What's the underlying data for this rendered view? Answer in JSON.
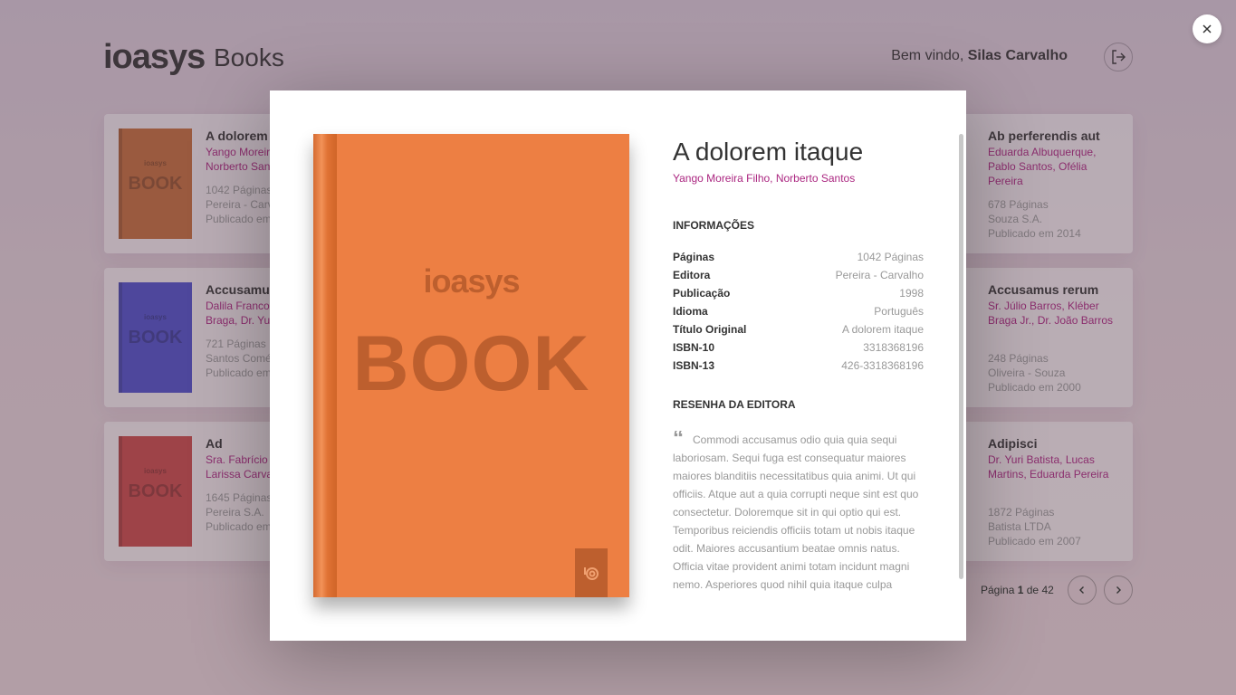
{
  "header": {
    "logo": "ioasys",
    "app_name": "Books",
    "welcome_prefix": "Bem vindo,",
    "user_name": "Silas Carvalho"
  },
  "cards_left": [
    {
      "title": "A dolorem i",
      "authors": [
        "Yango Moreir",
        "Norberto San"
      ],
      "pages": "1042 Páginas",
      "publisher": "Pereira - Carv",
      "published": "Publicado em",
      "color": "#c26a3a"
    },
    {
      "title": "Accusamus",
      "authors": [
        "Dalila Franco",
        "Braga, Dr. Yur"
      ],
      "pages": "721 Páginas",
      "publisher": "Santos Comé",
      "published": "Publicado em",
      "color": "#4d4ec8"
    },
    {
      "title": "Ad",
      "authors": [
        "Sra. Fabrício",
        "Larissa Carva"
      ],
      "pages": "1645 Páginas",
      "publisher": "Pereira S.A.",
      "published": "Publicado em",
      "color": "#c84848"
    }
  ],
  "cards_right": [
    {
      "title": "Ab perferendis aut",
      "authors": [
        "Eduarda Albuquerque,",
        "Pablo Santos, Ofélia",
        "Pereira"
      ],
      "pages": "678 Páginas",
      "publisher": "Souza S.A.",
      "published": "Publicado em 2014",
      "color": "#a02a86"
    },
    {
      "title": "Accusamus rerum",
      "authors": [
        "Sr. Júlio Barros, Kléber",
        "Braga Jr., Dr. João Barros"
      ],
      "pages": "248 Páginas",
      "publisher": "Oliveira - Souza",
      "published": "Publicado em 2000",
      "color": "#d07a3e"
    },
    {
      "title": "Adipisci",
      "authors": [
        "Dr. Yuri Batista, Lucas",
        "Martins, Eduarda Pereira"
      ],
      "pages": "1872 Páginas",
      "publisher": "Batista LTDA",
      "published": "Publicado em 2007",
      "color": "#a02a86"
    }
  ],
  "cover_labels": {
    "logo": "ioasys",
    "book": "BOOK"
  },
  "pagination": {
    "prefix": "Página",
    "current": "1",
    "separator": "de",
    "total": "42"
  },
  "modal": {
    "title": "A dolorem itaque",
    "authors": "Yango Moreira Filho, Norberto Santos",
    "cover_color": "#ed7f43",
    "info_heading": "INFORMAÇÕES",
    "info": [
      {
        "label": "Páginas",
        "value": "1042 Páginas"
      },
      {
        "label": "Editora",
        "value": "Pereira - Carvalho"
      },
      {
        "label": "Publicação",
        "value": "1998"
      },
      {
        "label": "Idioma",
        "value": "Português"
      },
      {
        "label": "Título Original",
        "value": "A dolorem itaque"
      },
      {
        "label": "ISBN-10",
        "value": "3318368196"
      },
      {
        "label": "ISBN-13",
        "value": "426-3318368196"
      }
    ],
    "review_heading": "RESENHA DA EDITORA",
    "review": "Commodi accusamus odio quia quia sequi laboriosam. Sequi fuga est consequatur maiores maiores blanditiis necessitatibus quia animi. Ut qui officiis. Atque aut a quia corrupti neque sint est quo consectetur. Doloremque sit in qui optio qui est. Temporibus reiciendis officiis totam ut nobis itaque odit. Maiores accusantium beatae omnis natus. Officia vitae provident animi totam incidunt magni nemo. Asperiores quod nihil quia itaque culpa"
  },
  "icons": {
    "close": "close-icon",
    "logout": "logout-icon",
    "prev": "chevron-left-icon",
    "next": "chevron-right-icon",
    "quote": "quote-icon"
  }
}
